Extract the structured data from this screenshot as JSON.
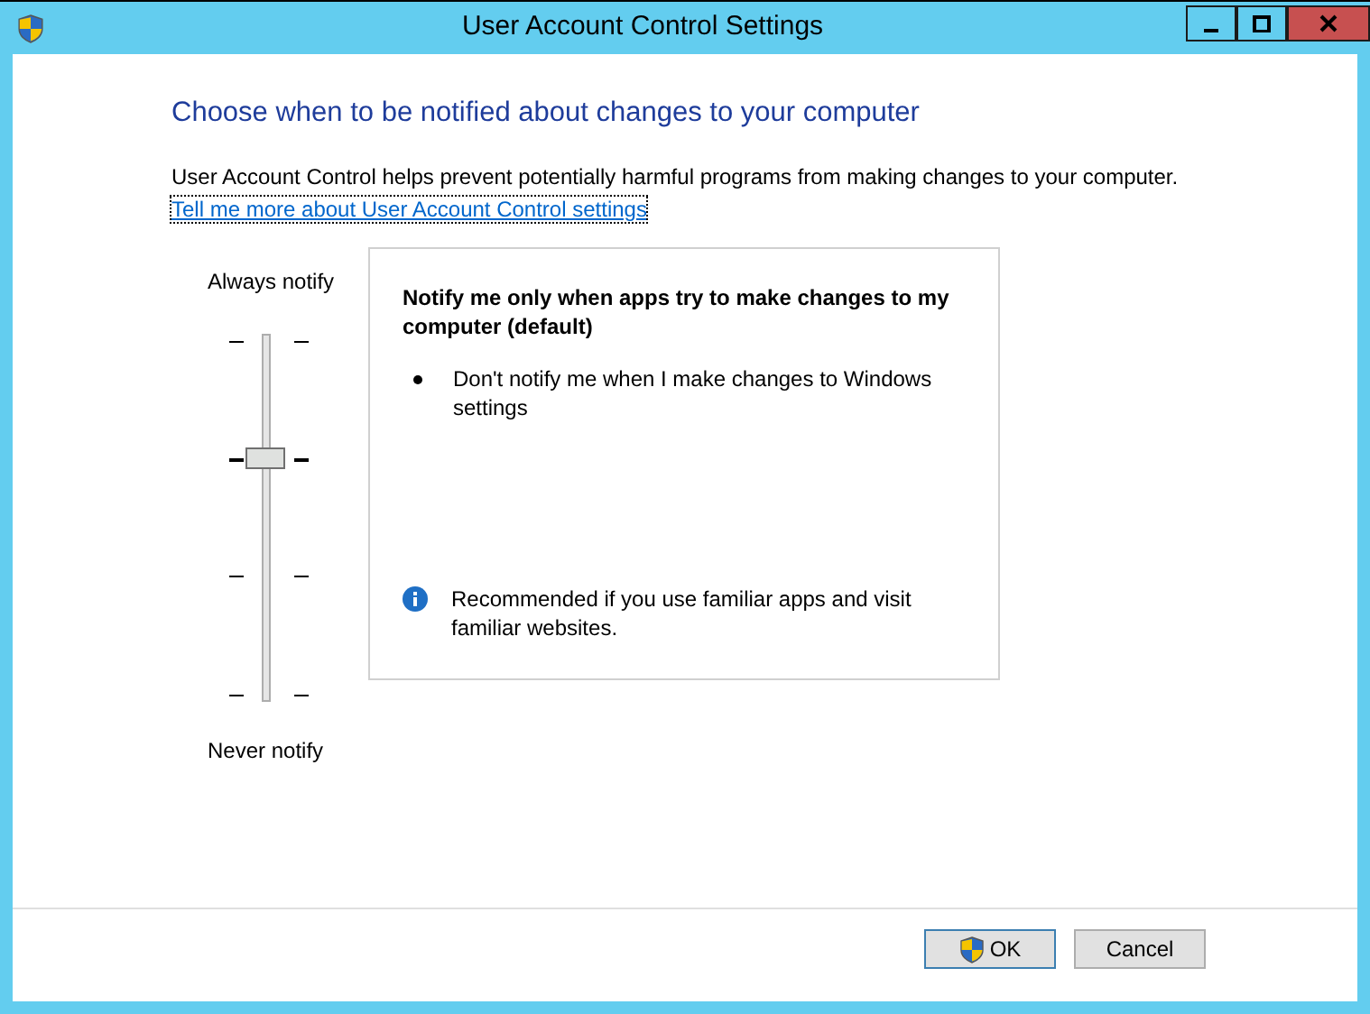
{
  "window": {
    "title": "User Account Control Settings"
  },
  "heading": "Choose when to be notified about changes to your computer",
  "description": "User Account Control helps prevent potentially harmful programs from making changes to your computer.",
  "link": "Tell me more about User Account Control settings",
  "slider": {
    "top_label": "Always notify",
    "bottom_label": "Never notify",
    "level": 0.667
  },
  "panel": {
    "title": "Notify me only when apps try to make changes to my computer (default)",
    "bullets": [
      "Don't notify me when I make changes to Windows settings"
    ],
    "note": "Recommended if you use familiar apps and visit familiar websites."
  },
  "buttons": [
    {
      "label": "OK",
      "shield": true
    },
    {
      "label": "Cancel",
      "shield": false
    }
  ]
}
